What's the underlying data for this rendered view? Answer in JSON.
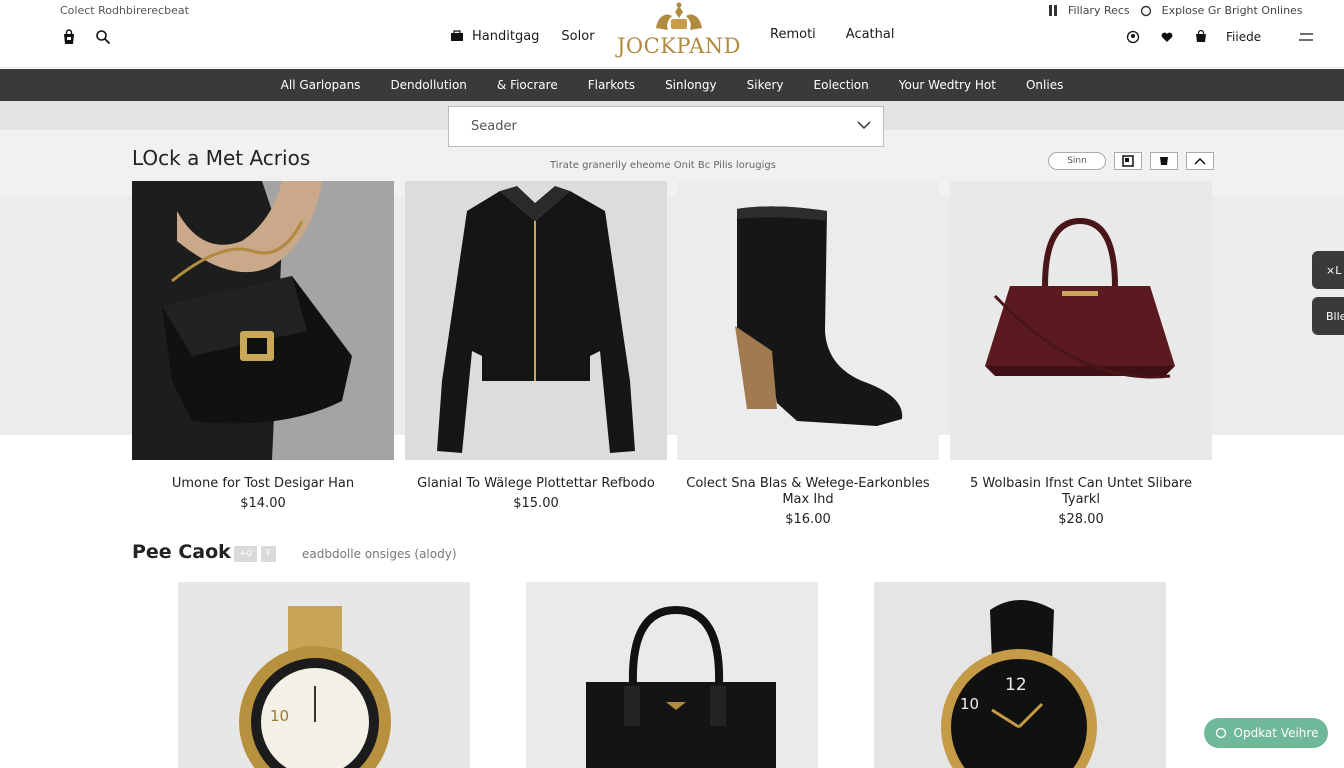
{
  "header": {
    "tagline": "Colect Rodhbirerecbeat",
    "left_nav": [
      "Handitgag",
      "Solor"
    ],
    "logo_text": "JOCKPAND",
    "right_nav": [
      "Remoti",
      "Acathal"
    ],
    "right_top": [
      "Fillary Recs",
      "Explose Gr Bright Onlines"
    ],
    "account_label": "Fiiede"
  },
  "category_nav": [
    "All Garlopans",
    "Dendollution",
    "& Fiocrare",
    "Flarkots",
    "Sinlongy",
    "Sikery",
    "Eolection",
    "Your Wedtry Hot",
    "Onlies"
  ],
  "search": {
    "placeholder": "Seader"
  },
  "section1": {
    "title": "LOck a Met Acrios",
    "caption": "Tirate granerily eheome Onit Bc Pilis lorugigs",
    "view_pill": "Sinn"
  },
  "products": [
    {
      "name": "Umone for Tost Desigar Han",
      "price": "$14.00"
    },
    {
      "name": "Glanial To Wälege Plottettar Refbodo",
      "price": "$15.00"
    },
    {
      "name": "Colect Sna Blas & Wełege-Earkonbles Max Ihd",
      "price": "$16.00"
    },
    {
      "name": "5 Wolbasin Ifnst Can Untet Slibare Tyarkl",
      "price": "$28.00"
    }
  ],
  "side_tabs": [
    "×L",
    "Blle"
  ],
  "section2": {
    "title": "Pee Caok",
    "tags": [
      "+0",
      "F"
    ],
    "note": "eadbdolle onsiges (alody)"
  },
  "chat": {
    "label": "Opdkat Veihre"
  },
  "colors": {
    "nav_bg": "#3a3a3a",
    "logo_gold": "#b08a3e",
    "chat_green": "#6fb89a"
  }
}
